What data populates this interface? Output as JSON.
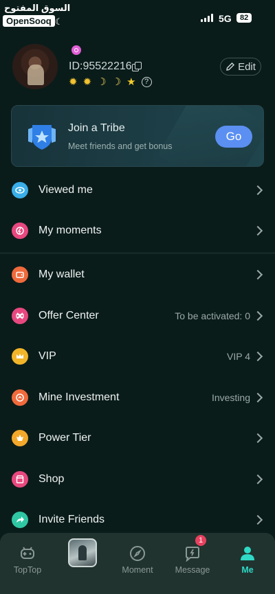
{
  "status_bar": {
    "watermark_arabic": "السوق المفتوح",
    "watermark_brand": "OpenSooq",
    "network": "5G",
    "battery": "82"
  },
  "profile": {
    "user_id": "ID:95522216",
    "edit_label": "Edit",
    "level_icons": [
      "sun-icon",
      "sun-icon",
      "moon-icon",
      "moon-icon",
      "star-icon"
    ]
  },
  "tribe_banner": {
    "title": "Join a Tribe",
    "subtitle": "Meet friends and get bonus",
    "go_label": "Go"
  },
  "menu": [
    {
      "label": "Viewed me",
      "value": "",
      "icon": "eye-icon",
      "color": "#3aaee8"
    },
    {
      "label": "My moments",
      "value": "",
      "icon": "moments-icon",
      "color": "#e8487f"
    },
    {
      "label": "My wallet",
      "value": "",
      "icon": "wallet-icon",
      "color": "#f06a3c"
    },
    {
      "label": "Offer Center",
      "value": "To be activated: 0",
      "icon": "offer-icon",
      "color": "#e8487f"
    },
    {
      "label": "VIP",
      "value": "VIP 4",
      "icon": "crown-icon",
      "color": "#f2b52a"
    },
    {
      "label": "Mine Investment",
      "value": "Investing",
      "icon": "investment-icon",
      "color": "#f06a3c"
    },
    {
      "label": "Power Tier",
      "value": "",
      "icon": "power-tier-icon",
      "color": "#f2a82a"
    },
    {
      "label": "Shop",
      "value": "",
      "icon": "shop-icon",
      "color": "#e8487f"
    },
    {
      "label": "Invite Friends",
      "value": "",
      "icon": "invite-icon",
      "color": "#2fc6a4"
    }
  ],
  "tabbar": {
    "tabs": [
      {
        "label": "TopTop",
        "icon": "game-icon"
      },
      {
        "label": "",
        "icon": "profile-thumbnail"
      },
      {
        "label": "Moment",
        "icon": "compass-icon"
      },
      {
        "label": "Message",
        "icon": "message-icon"
      },
      {
        "label": "Me",
        "icon": "person-icon"
      }
    ],
    "message_badge": "1",
    "active_color": "#2fd9c6"
  }
}
